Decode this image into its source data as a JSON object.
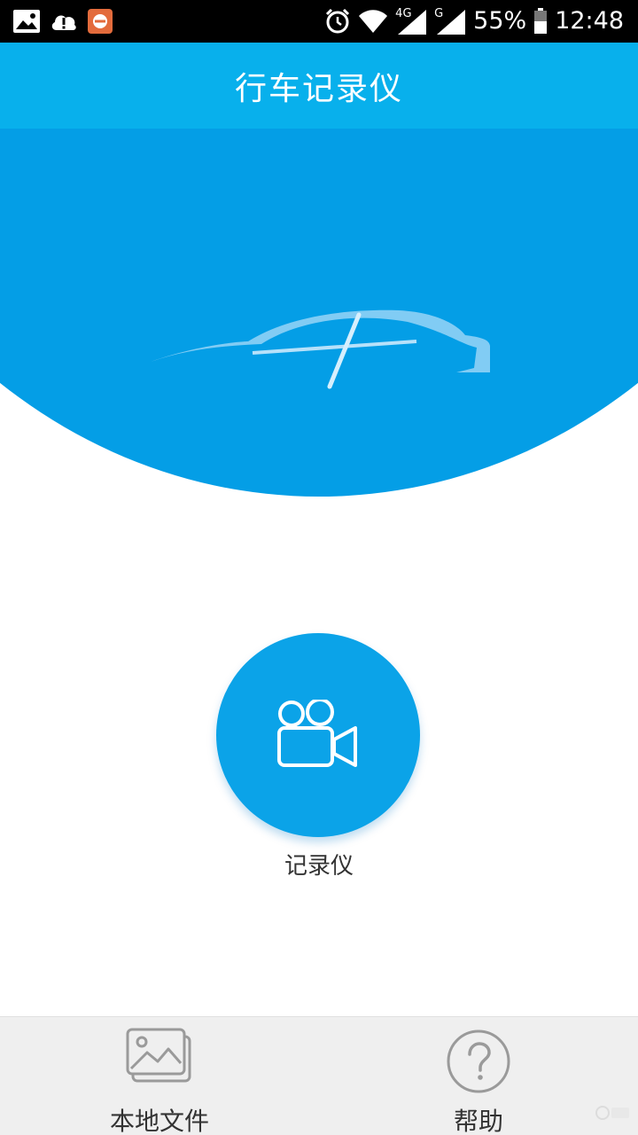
{
  "status_bar": {
    "battery": "55%",
    "time": "12:48",
    "net1": "4G",
    "net2": "G"
  },
  "header": {
    "title": "行车记录仪"
  },
  "main": {
    "record_label": "记录仪"
  },
  "bottom_nav": {
    "items": [
      {
        "label": "本地文件",
        "icon": "gallery-icon"
      },
      {
        "label": "帮助",
        "icon": "help-icon"
      }
    ]
  },
  "colors": {
    "header": "#08b0ec",
    "hero": "#049ee6",
    "button": "#0ba3e8",
    "nav_bg": "#efefef"
  }
}
